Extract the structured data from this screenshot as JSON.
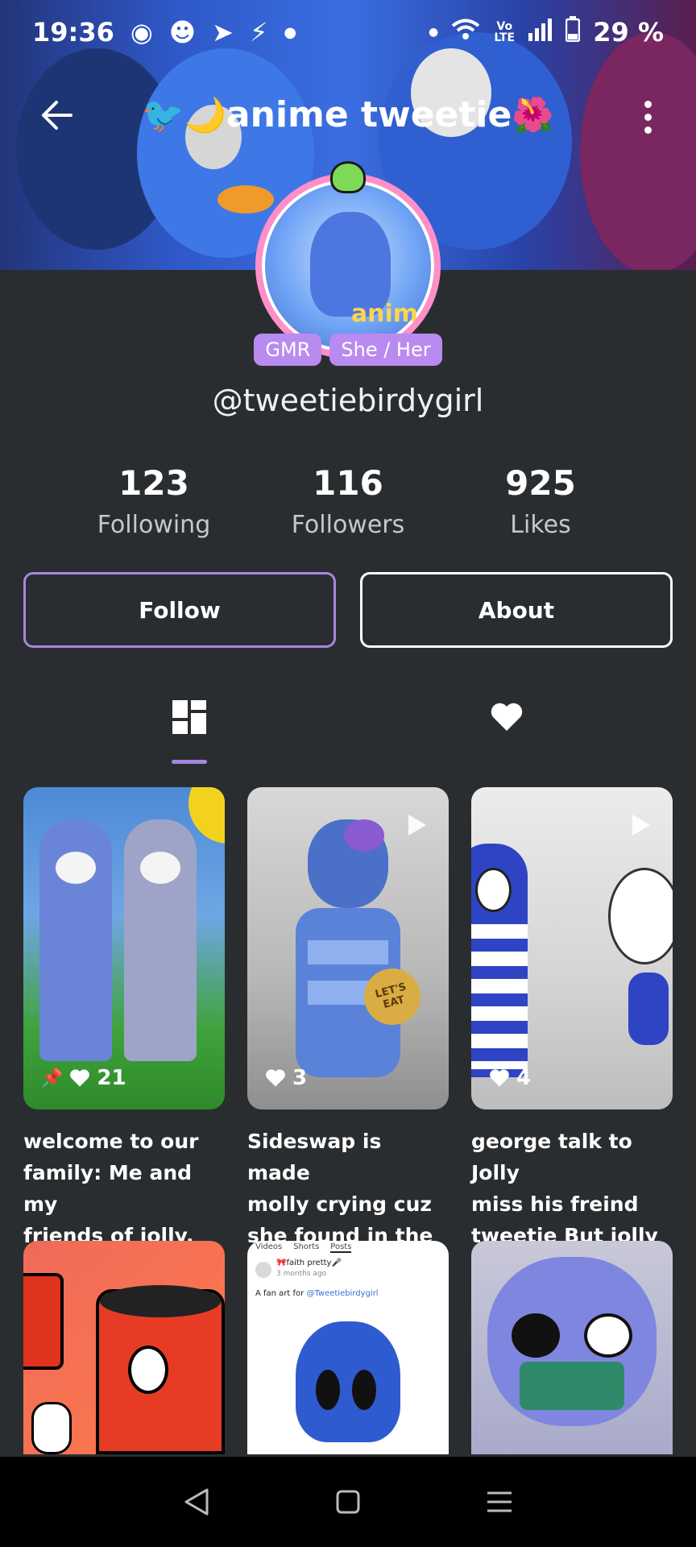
{
  "status_bar": {
    "time": "19:36",
    "battery": "29 %",
    "network_label": "Vo LTE"
  },
  "header": {
    "title_prefix_emoji": "🐦🌙",
    "title": "anime tweetie",
    "title_suffix_emoji": "🌺"
  },
  "profile": {
    "avatar_tag": "anim",
    "badges": [
      "GMR",
      "She / Her"
    ],
    "username": "@tweetiebirdygirl"
  },
  "stats": [
    {
      "value": "123",
      "label": "Following"
    },
    {
      "value": "116",
      "label": "Followers"
    },
    {
      "value": "925",
      "label": "Likes"
    }
  ],
  "actions": {
    "follow_label": "Follow",
    "about_label": "About"
  },
  "tabs": {
    "posts_icon": "grid-icon",
    "liked_icon": "heart-icon"
  },
  "posts": [
    {
      "likes": "21",
      "pinned": true,
      "caption_l1": "welcome to our",
      "caption_l2": "family: Me and my",
      "caption_l3": "friends of jolly, an..."
    },
    {
      "likes": "3",
      "pinned": false,
      "caption_l1": "Sideswap is made",
      "caption_l2": "molly crying cuz",
      "caption_l3": "she found in the f...",
      "thumb_text": "LET'S EAT"
    },
    {
      "likes": "4",
      "pinned": false,
      "caption_l1": "george talk to Jolly",
      "caption_l2": "miss his freind",
      "caption_l3": "tweetie But jolly i..."
    }
  ],
  "posts_row2": {
    "p5_tabs": [
      "Videos",
      "Shorts",
      "Posts"
    ],
    "p5_user": "🎀faith pretty🎤",
    "p5_time": "3 months ago",
    "p5_text_prefix": "A fan art for ",
    "p5_mention": "@Tweetiebirdygirl"
  },
  "colors": {
    "background": "#2a2d2f",
    "accent": "#a486e0",
    "badge": "#b98bf0"
  }
}
